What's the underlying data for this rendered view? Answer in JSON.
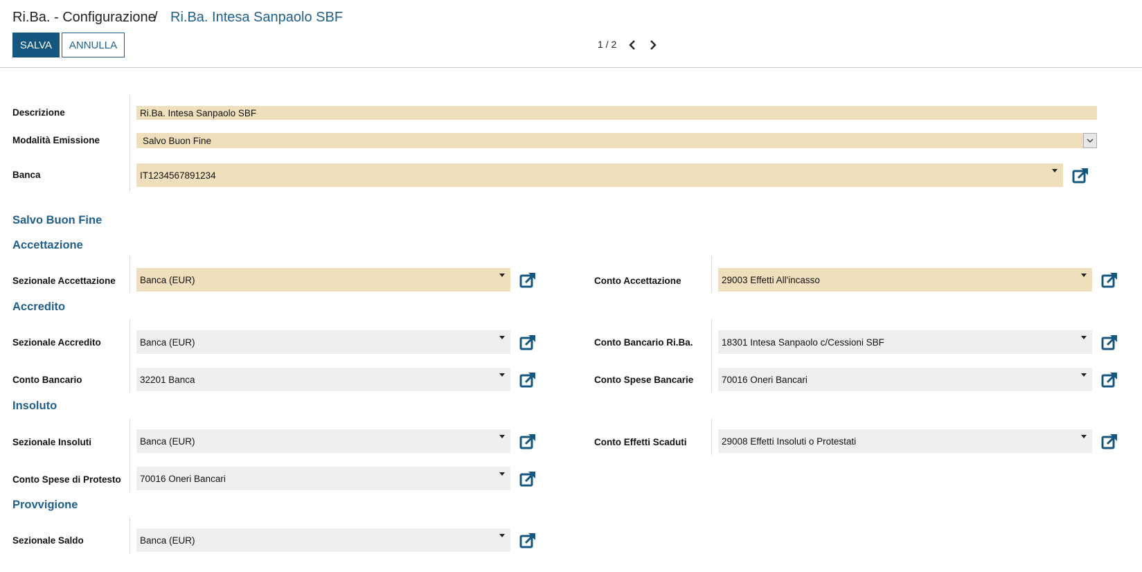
{
  "breadcrumb": {
    "root": "Ri.Ba. - Configurazione",
    "separator": "/",
    "current": "Ri.Ba. Intesa Sanpaolo SBF"
  },
  "toolbar": {
    "save_label": "SALVA",
    "cancel_label": "ANNULLA",
    "pager": "1 / 2"
  },
  "icons": {
    "prev": "chevron-left-icon",
    "next": "chevron-right-icon",
    "external": "external-link-icon",
    "dropdown": "caret-down-icon"
  },
  "colors": {
    "accent": "#1f5f8b",
    "primary_button": "#15567f",
    "required_field": "#f0dfbc",
    "optional_field": "#eeeeee"
  },
  "form": {
    "descrizione": {
      "label": "Descrizione",
      "value": "Ri.Ba. Intesa Sanpaolo SBF"
    },
    "modalita": {
      "label": "Modalità Emissione",
      "value": "Salvo Buon Fine"
    },
    "banca": {
      "label": "Banca",
      "value": "IT1234567891234"
    }
  },
  "mode_title": "Salvo Buon Fine",
  "sections": {
    "accettazione": {
      "title": "Accettazione",
      "sezionale": {
        "label": "Sezionale Accettazione",
        "value": "Banca (EUR)"
      },
      "conto": {
        "label": "Conto Accettazione",
        "value": "29003 Effetti All'incasso"
      }
    },
    "accredito": {
      "title": "Accredito",
      "sezionale": {
        "label": "Sezionale Accredito",
        "value": "Banca (EUR)"
      },
      "conto_riba": {
        "label": "Conto Bancario Ri.Ba.",
        "value": "18301 Intesa Sanpaolo c/Cessioni SBF"
      },
      "conto_bancario": {
        "label": "Conto Bancario",
        "value": "32201 Banca"
      },
      "conto_spese": {
        "label": "Conto Spese Bancarie",
        "value": "70016 Oneri Bancari"
      }
    },
    "insoluto": {
      "title": "Insoluto",
      "sezionale": {
        "label": "Sezionale Insoluti",
        "value": "Banca (EUR)"
      },
      "conto_scaduti": {
        "label": "Conto Effetti Scaduti",
        "value": "29008 Effetti Insoluti o Protestati"
      },
      "conto_protesto": {
        "label": "Conto Spese di Protesto",
        "value": "70016 Oneri Bancari"
      }
    },
    "provvigione": {
      "title": "Provvigione",
      "sezionale": {
        "label": "Sezionale Saldo",
        "value": "Banca (EUR)"
      }
    }
  }
}
